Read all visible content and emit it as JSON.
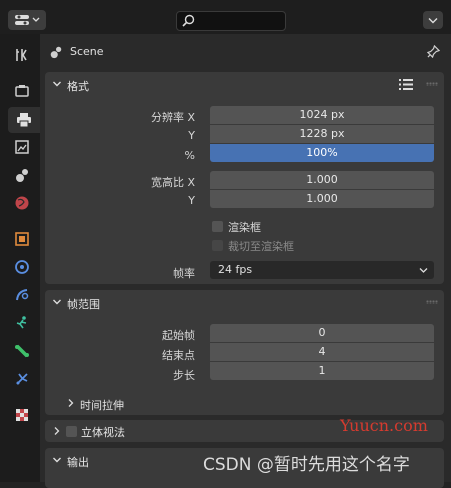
{
  "topbar": {
    "search_placeholder": ""
  },
  "header": {
    "title": "Scene"
  },
  "format_panel": {
    "title": "格式",
    "res_x_label": "分辨率 X",
    "res_y_label": "Y",
    "percent_label": "%",
    "res_x": "1024 px",
    "res_y": "1228 px",
    "res_percent": "100%",
    "aspect_x_label": "宽高比 X",
    "aspect_y_label": "Y",
    "aspect_x": "1.000",
    "aspect_y": "1.000",
    "render_region_label": "渲染框",
    "crop_label": "裁切至渲染框",
    "fps_label": "帧率",
    "fps_value": "24 fps"
  },
  "frame_panel": {
    "title": "帧范围",
    "start_label": "起始帧",
    "end_label": "结束点",
    "step_label": "步长",
    "start": "0",
    "end": "4",
    "step": "1",
    "time_stretch_label": "时间拉伸"
  },
  "stereo_panel": {
    "title": "立体视法"
  },
  "output_panel": {
    "title": "输出"
  },
  "watermarks": {
    "site": "Yuucn.com",
    "author": "CSDN @暂时先用这个名字"
  },
  "colors": {
    "accent_blue": "#4772b3",
    "panel_bg": "#3a3a3a",
    "field_bg": "#545454"
  }
}
